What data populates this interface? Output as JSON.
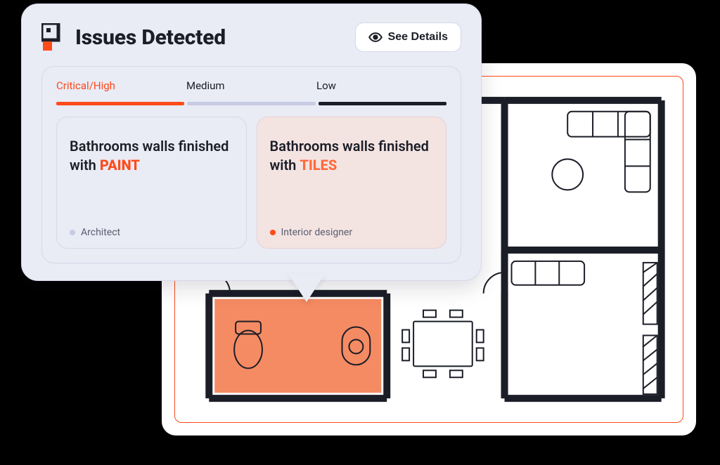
{
  "card": {
    "title": "Issues Detected",
    "see_details": "See Details"
  },
  "severity": {
    "critical": "Critical/High",
    "medium": "Medium",
    "low": "Low"
  },
  "issues": [
    {
      "prefix": "Bathrooms walls finished with ",
      "highlight": "PAINT",
      "role": "Architect"
    },
    {
      "prefix": "Bathrooms walls finished with ",
      "highlight": "TILES",
      "role": "Interior designer"
    }
  ],
  "colors": {
    "accent": "#ff4a1a",
    "panel": "#e9ebf5"
  }
}
